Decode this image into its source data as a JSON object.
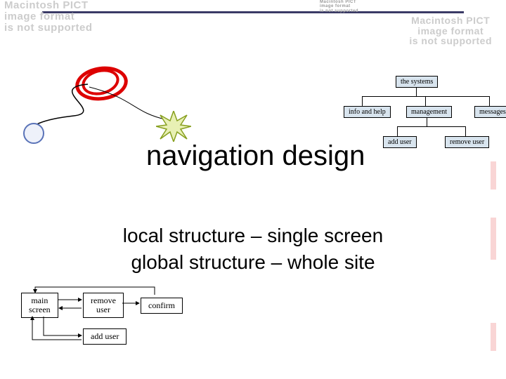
{
  "unsupported_text": "Macintosh PICT\nimage format\nis not supported",
  "hierarchy": {
    "root": "the systems",
    "level1": [
      "info and help",
      "management",
      "messages"
    ],
    "level2": [
      "add user",
      "remove user"
    ]
  },
  "title": "navigation design",
  "subtitle1": "local structure – single screen",
  "subtitle2": "global structure – whole site",
  "flow": {
    "main_screen": "main\nscreen",
    "remove_user": "remove\nuser",
    "confirm": "confirm",
    "add_user": "add user"
  }
}
